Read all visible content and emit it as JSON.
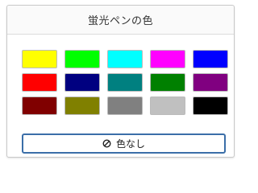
{
  "panel": {
    "title": "蛍光ペンの色"
  },
  "swatches": [
    {
      "name": "yellow",
      "color": "#ffff00"
    },
    {
      "name": "bright-green",
      "color": "#00ff00"
    },
    {
      "name": "cyan",
      "color": "#00ffff"
    },
    {
      "name": "magenta",
      "color": "#ff00ff"
    },
    {
      "name": "blue",
      "color": "#0000ff"
    },
    {
      "name": "red",
      "color": "#ff0000"
    },
    {
      "name": "navy",
      "color": "#000080"
    },
    {
      "name": "teal",
      "color": "#008080"
    },
    {
      "name": "green",
      "color": "#008000"
    },
    {
      "name": "purple",
      "color": "#800080"
    },
    {
      "name": "maroon",
      "color": "#800000"
    },
    {
      "name": "olive",
      "color": "#808000"
    },
    {
      "name": "gray",
      "color": "#808080"
    },
    {
      "name": "silver",
      "color": "#c0c0c0"
    },
    {
      "name": "black",
      "color": "#000000"
    }
  ],
  "no_color_button": {
    "label": "色なし",
    "icon": "no-entry-icon"
  }
}
